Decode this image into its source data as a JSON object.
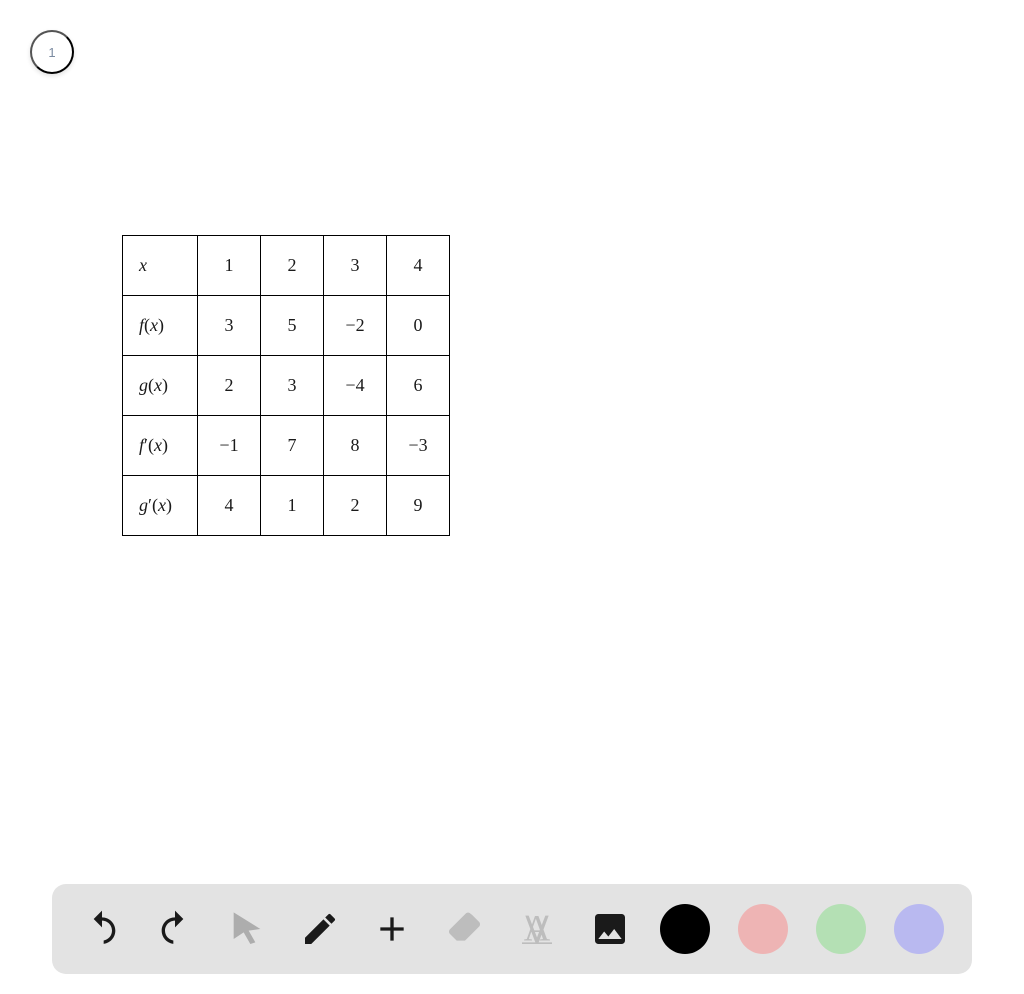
{
  "page_number": "1",
  "table": {
    "header_label": "x",
    "columns": [
      "1",
      "2",
      "3",
      "4"
    ],
    "rows": [
      {
        "label_base": "f",
        "label_prime": false,
        "values": [
          "3",
          "5",
          "−2",
          "0"
        ]
      },
      {
        "label_base": "g",
        "label_prime": false,
        "values": [
          "2",
          "3",
          "−4",
          "6"
        ]
      },
      {
        "label_base": "f",
        "label_prime": true,
        "values": [
          "−1",
          "7",
          "8",
          "−3"
        ]
      },
      {
        "label_base": "g",
        "label_prime": true,
        "values": [
          "4",
          "1",
          "2",
          "9"
        ]
      }
    ]
  },
  "chart_data": {
    "type": "table",
    "title": "",
    "columns": [
      "x",
      "1",
      "2",
      "3",
      "4"
    ],
    "rows": [
      {
        "label": "f(x)",
        "values": [
          3,
          5,
          -2,
          0
        ]
      },
      {
        "label": "g(x)",
        "values": [
          2,
          3,
          -4,
          6
        ]
      },
      {
        "label": "f'(x)",
        "values": [
          -1,
          7,
          8,
          -3
        ]
      },
      {
        "label": "g'(x)",
        "values": [
          4,
          1,
          2,
          9
        ]
      }
    ]
  },
  "toolbar": {
    "undo": "Undo",
    "redo": "Redo",
    "pointer": "Pointer",
    "pencil": "Pencil",
    "add": "Add",
    "eraser": "Eraser",
    "text": "Text",
    "image": "Image"
  },
  "colors": {
    "black": "#000000",
    "red": "#eeb4b4",
    "green": "#b4e0b4",
    "purple": "#b9b9f0"
  }
}
